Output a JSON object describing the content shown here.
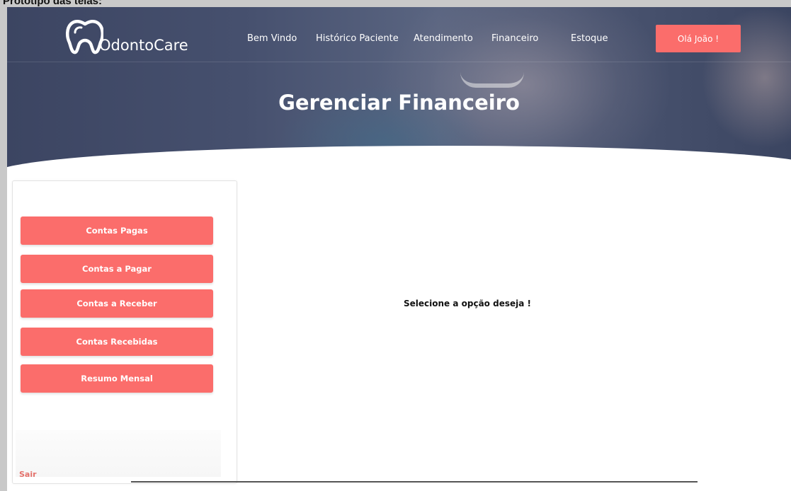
{
  "caption": "Protótipo das telas:",
  "brand": {
    "name": "OdontoCare",
    "icon": "tooth-icon"
  },
  "nav": {
    "items": [
      {
        "label": "Bem Vindo"
      },
      {
        "label": "Histórico Paciente"
      },
      {
        "label": "Atendimento"
      },
      {
        "label": "Financeiro"
      },
      {
        "label": "Estoque"
      }
    ],
    "greeting": "Olá João !"
  },
  "page": {
    "title": "Gerenciar Financeiro"
  },
  "sidebar": {
    "buttons": [
      {
        "label": "Contas Pagas"
      },
      {
        "label": "Contas a Pagar"
      },
      {
        "label": "Contas a Receber"
      },
      {
        "label": "Contas Recebidas"
      },
      {
        "label": "Resumo Mensal"
      }
    ],
    "logout": "Sair"
  },
  "content": {
    "message": "Selecione a opção deseja !"
  },
  "colors": {
    "accent": "#fb6d6b",
    "hero": "#3c4562",
    "logout": "#e4716b"
  }
}
